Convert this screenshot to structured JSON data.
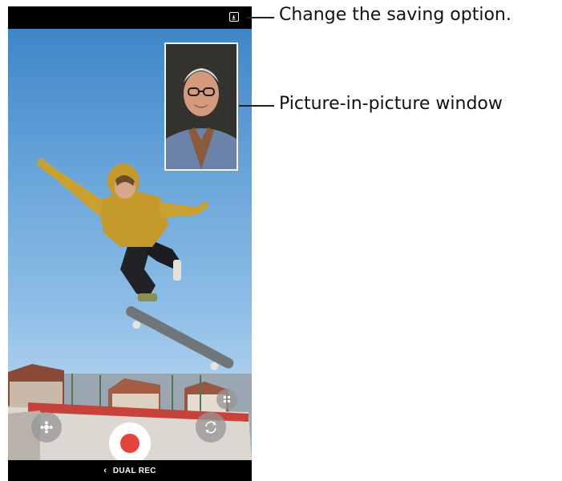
{
  "annotations": {
    "saving_option": "Change the saving option.",
    "pip_window": "Picture-in-picture window"
  },
  "camera": {
    "mode_label": "DUAL REC",
    "back_chevron": "‹",
    "record_color": "#e2443b"
  },
  "icons": {
    "save": "save-option-icon",
    "effects": "filter-effects-icon",
    "record": "record-icon",
    "switch": "switch-camera-icon",
    "layout": "pip-layout-icon"
  }
}
